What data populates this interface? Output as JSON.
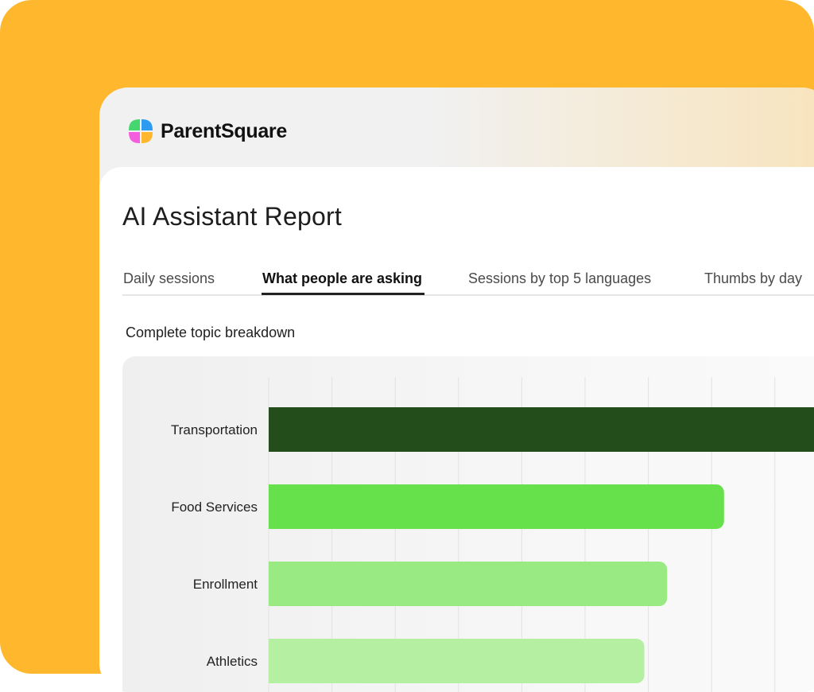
{
  "brand": {
    "name": "ParentSquare",
    "logo_colors": [
      "#45D66E",
      "#2D9CF0",
      "#F45FE0",
      "#FFB82E"
    ],
    "background_accent": "#FFB82E"
  },
  "report": {
    "title": "AI Assistant Report",
    "tabs": [
      {
        "label": "Daily sessions",
        "active": false
      },
      {
        "label": "What people are asking",
        "active": true
      },
      {
        "label": "Sessions by top 5 languages",
        "active": false
      },
      {
        "label": "Thumbs by day",
        "active": false
      }
    ],
    "subtitle": "Complete topic breakdown"
  },
  "chart_data": {
    "type": "bar",
    "orientation": "horizontal",
    "title": "Complete topic breakdown",
    "categories": [
      "Transportation",
      "Food Services",
      "Enrollment",
      "Athletics"
    ],
    "values": [
      100,
      80,
      70,
      66
    ],
    "value_unit": "relative",
    "grid": true,
    "bar_colors": [
      "#234D1B",
      "#66E04B",
      "#9AEA84",
      "#B4EFA2"
    ]
  }
}
